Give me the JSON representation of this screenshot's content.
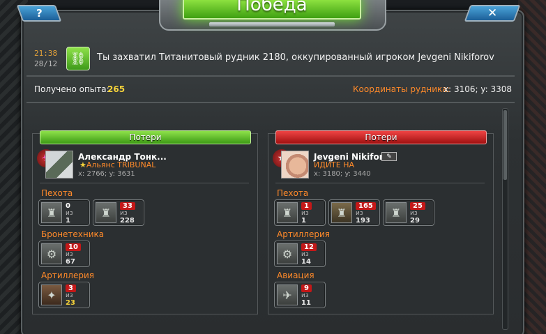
{
  "dialog": {
    "title": "Победа",
    "help_label": "?",
    "close_label": "✕"
  },
  "message": {
    "time": "21:38",
    "date": "28/12",
    "icon": "handcuffs-icon",
    "text": "Ты захватил Титанитовый рудник 2180, оккупированный игроком Jevgeni Nikiforov"
  },
  "summary": {
    "exp_label": "Получено опыта:",
    "exp_value": "265",
    "coord_label": "Координаты рудника:",
    "coord_value": "x: 3106; y: 3308"
  },
  "left_panel": {
    "header": "Потери",
    "header_color": "#4fb21c",
    "player": {
      "name": "Александр Тонк...",
      "alliance": "Альянс TRIBUNAL",
      "coords": "x: 2766; y: 3631"
    },
    "categories": [
      {
        "label": "Пехота",
        "units": [
          {
            "lost": "0",
            "of": "из",
            "total": "1"
          },
          {
            "lost": "33",
            "of": "из",
            "total": "228"
          }
        ]
      },
      {
        "label": "Бронетехника",
        "units": [
          {
            "lost": "10",
            "of": "из",
            "total": "67"
          }
        ]
      },
      {
        "label": "Артиллерия",
        "units": [
          {
            "lost": "3",
            "of": "из",
            "total": "23"
          }
        ]
      }
    ]
  },
  "right_panel": {
    "header": "Потери",
    "header_color": "#c41818",
    "player": {
      "name": "Jevgeni Nikiforov",
      "action": "ИДИТЕ НА",
      "coords": "x: 3180; y: 3440"
    },
    "categories": [
      {
        "label": "Пехота",
        "units": [
          {
            "lost": "1",
            "of": "из",
            "total": "1"
          },
          {
            "lost": "165",
            "of": "из",
            "total": "193"
          },
          {
            "lost": "25",
            "of": "из",
            "total": "29"
          }
        ]
      },
      {
        "label": "Артиллерия",
        "units": [
          {
            "lost": "12",
            "of": "из",
            "total": "14"
          }
        ]
      },
      {
        "label": "Авиация",
        "units": [
          {
            "lost": "9",
            "of": "из",
            "total": "11"
          }
        ]
      }
    ]
  }
}
